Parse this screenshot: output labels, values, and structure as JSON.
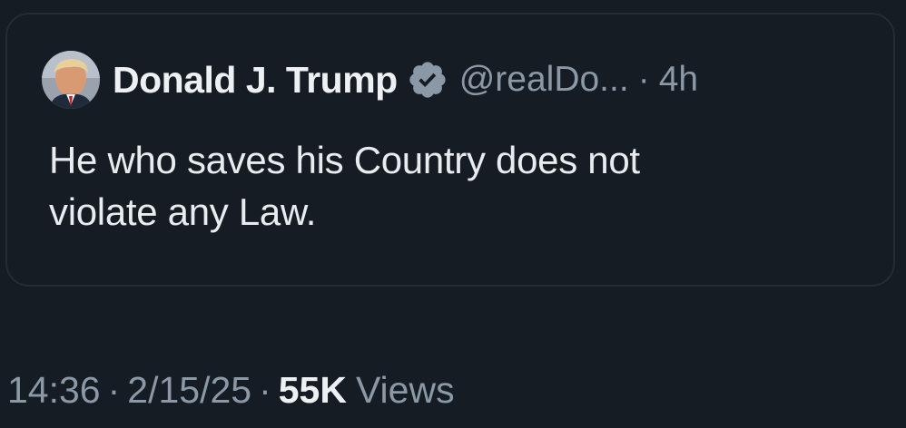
{
  "tweet": {
    "author": {
      "display_name": "Donald J. Trump",
      "handle": "@realDo...",
      "verified": true,
      "verified_icon": "verified-badge-icon"
    },
    "separator": "·",
    "relative_time": "4h",
    "text_lines": [
      "He who saves his Country does not",
      "violate any Law."
    ]
  },
  "footer": {
    "time": "14:36",
    "date": "2/15/25",
    "views_count": "55K",
    "views_label": "Views",
    "separator": "·"
  },
  "colors": {
    "background": "#161c24",
    "card_border": "#262c33",
    "text_primary": "#e7e9ea",
    "text_secondary": "#8b98a5",
    "badge": "#8b98a5"
  }
}
